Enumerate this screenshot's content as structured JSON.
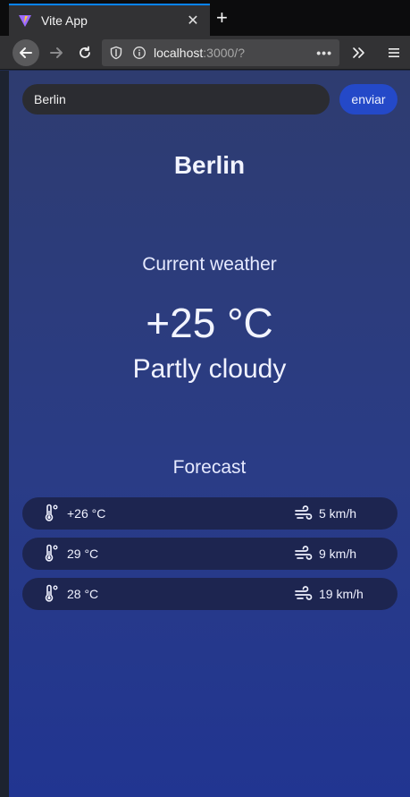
{
  "browser": {
    "tab_title": "Vite App",
    "tab_close": "✕",
    "new_tab": "+",
    "url_host": "localhost",
    "url_rest": ":3000/?",
    "url_more": "•••"
  },
  "search": {
    "value": "Berlin",
    "button_label": "enviar"
  },
  "weather": {
    "city": "Berlin",
    "current_label": "Current weather",
    "temperature": "+25 °C",
    "condition": "Partly cloudy"
  },
  "forecast": {
    "label": "Forecast",
    "items": [
      {
        "temperature": "+26 °C",
        "wind": "5 km/h"
      },
      {
        "temperature": "29 °C",
        "wind": "9 km/h"
      },
      {
        "temperature": "28 °C",
        "wind": "19 km/h"
      }
    ]
  },
  "icons": {
    "favicon": "vite-logo-icon",
    "back": "arrow-left-icon",
    "forward": "arrow-right-icon",
    "reload": "reload-icon",
    "shield": "shield-icon",
    "info": "info-icon",
    "overflow": "double-chevron-right-icon",
    "menu": "hamburger-menu-icon",
    "thermometer": "thermometer-icon",
    "wind": "wind-icon"
  },
  "colors": {
    "accent": "#2449c8",
    "tab_highlight": "#0a84ff"
  }
}
